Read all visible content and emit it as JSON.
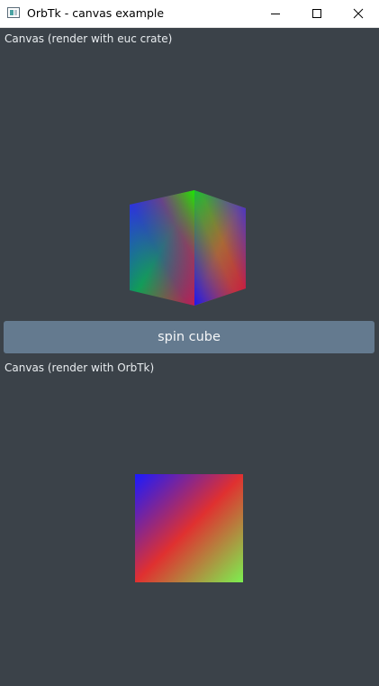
{
  "window": {
    "title": "OrbTk - canvas example",
    "controls": {
      "minimize_icon": "minimize-icon",
      "maximize_icon": "maximize-icon",
      "close_icon": "close-icon"
    }
  },
  "top_section": {
    "label": "Canvas (render with euc crate)",
    "colors": [
      "#ff0000",
      "#00ff00",
      "#0000ff"
    ]
  },
  "spin_button": {
    "label": "spin cube",
    "color": "#647a8f"
  },
  "bottom_section": {
    "label": "Canvas (render with OrbTk)",
    "colors": [
      "#1a1aff",
      "#e03030",
      "#7cf050"
    ]
  },
  "theme": {
    "background": "#3b4249",
    "text": "#e8ecef"
  }
}
